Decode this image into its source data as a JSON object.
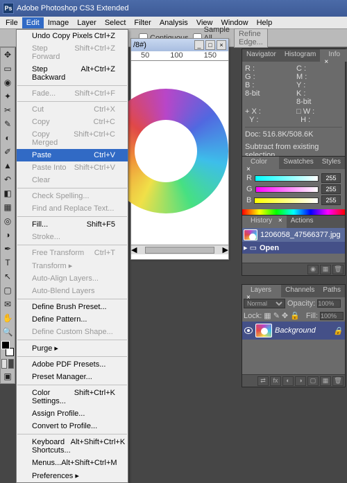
{
  "app": {
    "title": "Adobe Photoshop CS3 Extended"
  },
  "menubar": [
    "File",
    "Edit",
    "Image",
    "Layer",
    "Select",
    "Filter",
    "Analysis",
    "View",
    "Window",
    "Help"
  ],
  "options": {
    "contiguous": "Contiguous",
    "sample": "Sample All Layers",
    "refine": "Refine Edge..."
  },
  "edit_menu": [
    {
      "t": "items",
      "v": [
        {
          "l": "Undo Copy Pixels",
          "s": "Ctrl+Z"
        },
        {
          "l": "Step Forward",
          "s": "Shift+Ctrl+Z",
          "d": true
        },
        {
          "l": "Step Backward",
          "s": "Alt+Ctrl+Z"
        }
      ]
    },
    {
      "t": "sep"
    },
    {
      "t": "items",
      "v": [
        {
          "l": "Fade...",
          "s": "Shift+Ctrl+F",
          "d": true
        }
      ]
    },
    {
      "t": "sep"
    },
    {
      "t": "items",
      "v": [
        {
          "l": "Cut",
          "s": "Ctrl+X",
          "d": true
        },
        {
          "l": "Copy",
          "s": "Ctrl+C",
          "d": true
        },
        {
          "l": "Copy Merged",
          "s": "Shift+Ctrl+C",
          "d": true
        },
        {
          "l": "Paste",
          "s": "Ctrl+V",
          "hl": true
        },
        {
          "l": "Paste Into",
          "s": "Shift+Ctrl+V",
          "d": true
        },
        {
          "l": "Clear",
          "d": true
        }
      ]
    },
    {
      "t": "sep"
    },
    {
      "t": "items",
      "v": [
        {
          "l": "Check Spelling...",
          "d": true
        },
        {
          "l": "Find and Replace Text...",
          "d": true
        }
      ]
    },
    {
      "t": "sep"
    },
    {
      "t": "items",
      "v": [
        {
          "l": "Fill...",
          "s": "Shift+F5"
        },
        {
          "l": "Stroke...",
          "d": true
        }
      ]
    },
    {
      "t": "sep"
    },
    {
      "t": "items",
      "v": [
        {
          "l": "Free Transform",
          "s": "Ctrl+T",
          "d": true
        },
        {
          "l": "Transform",
          "d": true,
          "sub": true
        },
        {
          "l": "Auto-Align Layers...",
          "d": true
        },
        {
          "l": "Auto-Blend Layers",
          "d": true
        }
      ]
    },
    {
      "t": "sep"
    },
    {
      "t": "items",
      "v": [
        {
          "l": "Define Brush Preset..."
        },
        {
          "l": "Define Pattern..."
        },
        {
          "l": "Define Custom Shape...",
          "d": true
        }
      ]
    },
    {
      "t": "sep"
    },
    {
      "t": "items",
      "v": [
        {
          "l": "Purge",
          "sub": true
        }
      ]
    },
    {
      "t": "sep"
    },
    {
      "t": "items",
      "v": [
        {
          "l": "Adobe PDF Presets..."
        },
        {
          "l": "Preset Manager..."
        }
      ]
    },
    {
      "t": "sep"
    },
    {
      "t": "items",
      "v": [
        {
          "l": "Color Settings...",
          "s": "Shift+Ctrl+K"
        },
        {
          "l": "Assign Profile..."
        },
        {
          "l": "Convert to Profile..."
        }
      ]
    },
    {
      "t": "sep"
    },
    {
      "t": "items",
      "v": [
        {
          "l": "Keyboard Shortcuts...",
          "s": "Alt+Shift+Ctrl+K"
        },
        {
          "l": "Menus...",
          "s": "Alt+Shift+Ctrl+M"
        },
        {
          "l": "Preferences",
          "sub": true
        }
      ]
    }
  ],
  "doc": {
    "title": "/8#)",
    "ruler": [
      "50",
      "100",
      "150"
    ]
  },
  "info": {
    "r": "R :",
    "g": "G :",
    "b": "B :",
    "bit1": "8-bit",
    "c": "C :",
    "m": "M :",
    "y": "Y :",
    "k": "K :",
    "bit2": "8-bit",
    "x": "X :",
    "yl": "Y :",
    "w": "W :",
    "h": "H :",
    "docsize": "Doc: 516.8K/508.6K",
    "hint": "Subtract from existing selection."
  },
  "tabs": {
    "navigator": "Navigator",
    "histogram": "Histogram",
    "info": "Info",
    "color": "Color",
    "swatches": "Swatches",
    "styles": "Styles",
    "history": "History",
    "actions": "Actions",
    "layers": "Layers",
    "channels": "Channels",
    "paths": "Paths"
  },
  "color": {
    "r": "R",
    "g": "G",
    "b": "B",
    "val": "255"
  },
  "history": {
    "file": "1206058_47566377.jpg",
    "open": "Open"
  },
  "layers": {
    "mode": "Normal",
    "opacity": "Opacity:",
    "opv": "100%",
    "lock": "Lock:",
    "fill": "Fill:",
    "fillv": "100%",
    "bg": "Background"
  }
}
